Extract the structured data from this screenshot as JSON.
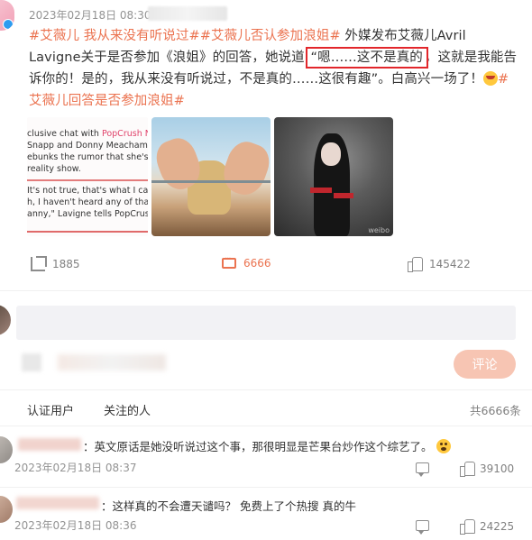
{
  "post": {
    "timestamp": "2023年02月18日 08:30",
    "tag1": "#艾薇儿 我从来没有听说过#",
    "tag2": "#艾薇儿否认参加浪姐#",
    "text_a": " 外媒发布艾薇儿Avril Lavigne关于是否参加《浪姐》的回答，她说道 ",
    "quote_highlight": "“嗯……这不是真的",
    "text_b": "，这就是我能告诉你的！是的，我从来没有听说过，不是真的……这很有趣”。白高兴一场了！",
    "tag3": "#艾薇儿回答是否参加浪姐#",
    "image1_lines": [
      "clusive chat with ",
      "PopCrush Nights",
      " ho",
      "Snapp and Donny Meacham, the 'I'm",
      "ebunks the rumor that she's been cas",
      " reality show.",
      "It's not true, that's what I can tell you",
      "h, I haven't heard any of that, not true",
      "anny,\" Lavigne tells PopCrush Nights."
    ],
    "image3_watermark": "weibo"
  },
  "actions": {
    "share_count": "1885",
    "comment_count": "6666",
    "like_count": "145422"
  },
  "composer": {
    "placeholder": "",
    "submit_label": "评论"
  },
  "filters": {
    "verified": "认证用户",
    "following": "关注的人",
    "total": "共6666条"
  },
  "comments": [
    {
      "text": "：英文原话是她没听说过这个事，那很明显是芒果台炒作这个综艺了。",
      "time": "2023年02月18日 08:37",
      "likes": "39100"
    },
    {
      "text": "：这样真的不会遭天谴吗？ 免费上了个热搜 真的牛",
      "time": "2023年02月18日 08:36",
      "likes": "24225"
    }
  ],
  "colors": {
    "accent": "#eb7350",
    "highlight_box": "#e2262b",
    "submit_disabled": "#f7c5b3"
  }
}
